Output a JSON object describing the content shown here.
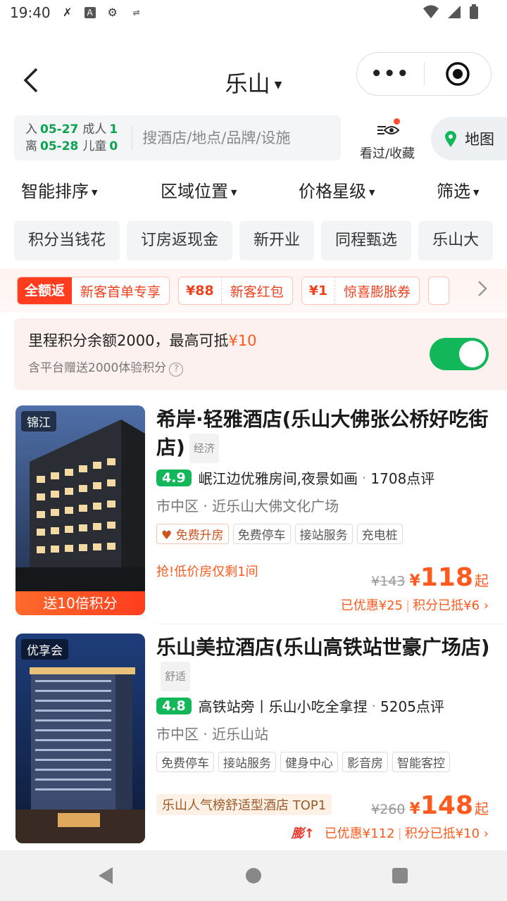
{
  "status_bar": {
    "time": "19:40"
  },
  "header": {
    "title": "乐山"
  },
  "search": {
    "checkin_label": "入",
    "checkin_date": "05-27",
    "checkout_label": "离",
    "checkout_date": "05-28",
    "adults_label": "成人",
    "adults": "1",
    "children_label": "儿童",
    "children": "0",
    "placeholder": "搜酒店/地点/品牌/设施",
    "viewed_label": "看过/收藏",
    "map_label": "地图"
  },
  "filters": [
    "智能排序",
    "区域位置",
    "价格星级",
    "筛选"
  ],
  "chips": [
    "积分当钱花",
    "订房返现金",
    "新开业",
    "同程甄选",
    "乐山大"
  ],
  "coupons": [
    {
      "head": "全额返",
      "text": "新客首单专享"
    },
    {
      "amount": "¥88",
      "text": "新客红包"
    },
    {
      "amount": "¥1",
      "text": "惊喜膨胀券"
    }
  ],
  "points": {
    "line1_prefix": "里程积分余额2000，最高可抵",
    "line1_amount": "¥10",
    "line2": "含平台赠送2000体验积分",
    "enabled": true
  },
  "hotels": [
    {
      "brand": "锦江",
      "promo": "送10倍积分",
      "name": "希岸·轻雅酒店(乐山大佛张公桥好吃街店)",
      "class": "经济",
      "score": "4.9",
      "highlight": "岷江边优雅房间,夜景如画",
      "reviews": "1708点评",
      "location": "市中区 · 近乐山大佛文化广场",
      "tags": [
        "免费升房",
        "免费停车",
        "接站服务",
        "充电桩"
      ],
      "urgent": "抢!低价房仅剩1间",
      "old_price": "¥143",
      "price": "118",
      "price_suffix": "起",
      "discount": "已优惠¥25",
      "points_used": "积分已抵¥6"
    },
    {
      "brand": "优享会",
      "name": "乐山美拉酒店(乐山高铁站世豪广场店)",
      "class": "舒适",
      "score": "4.8",
      "highlight": "高铁站旁丨乐山小吃全拿捏",
      "reviews": "5205点评",
      "location": "市中区 · 近乐山站",
      "tags": [
        "免费停车",
        "接站服务",
        "健身中心",
        "影音房",
        "智能客控"
      ],
      "rank": "乐山人气榜舒适型酒店 TOP1",
      "boost": "膨",
      "old_price": "¥260",
      "price": "148",
      "price_suffix": "起",
      "discount": "已优惠¥112",
      "points_used": "积分已抵¥10"
    }
  ],
  "colors": {
    "accent_green": "#12b75a",
    "accent_orange": "#ff5a1e"
  }
}
